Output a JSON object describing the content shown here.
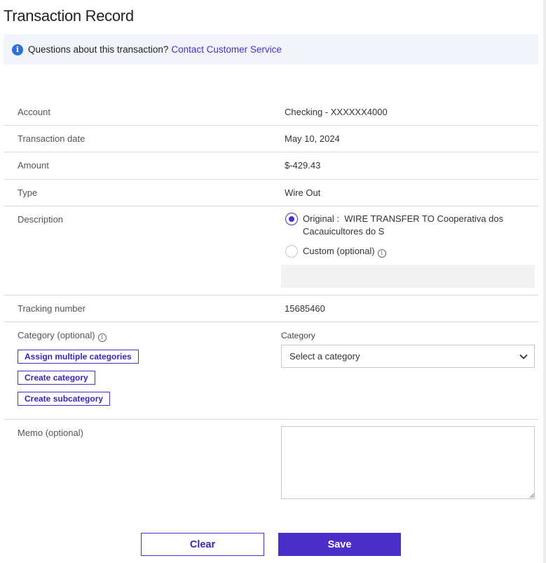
{
  "page": {
    "title": "Transaction Record"
  },
  "banner": {
    "text": "Questions about this transaction?",
    "link": "Contact Customer Service",
    "icon": "info-icon"
  },
  "fields": {
    "account": {
      "label": "Account",
      "value": "Checking - XXXXXX4000"
    },
    "date": {
      "label": "Transaction date",
      "value": "May 10, 2024"
    },
    "amount": {
      "label": "Amount",
      "value": "$-429.43"
    },
    "type": {
      "label": "Type",
      "value": "Wire Out"
    },
    "description": {
      "label": "Description",
      "original_label": "Original :",
      "original_line1": "WIRE TRANSFER TO Cooperativa dos",
      "original_line2": "Cacauicultores do S",
      "custom_label": "Custom (optional)",
      "selected": "original"
    },
    "tracking": {
      "label": "Tracking number",
      "value": "15685460"
    },
    "category": {
      "label": "Category (optional)",
      "assign_multiple": "Assign multiple categories",
      "create_category": "Create category",
      "create_subcategory": "Create subcategory",
      "select_label": "Category",
      "select_value": "Select a category"
    },
    "memo": {
      "label": "Memo (optional)",
      "value": ""
    }
  },
  "actions": {
    "clear": "Clear",
    "save": "Save"
  },
  "colors": {
    "accent": "#4b2ec9",
    "banner_bg": "#f1f4fb",
    "info_icon": "#2f6fd8"
  }
}
